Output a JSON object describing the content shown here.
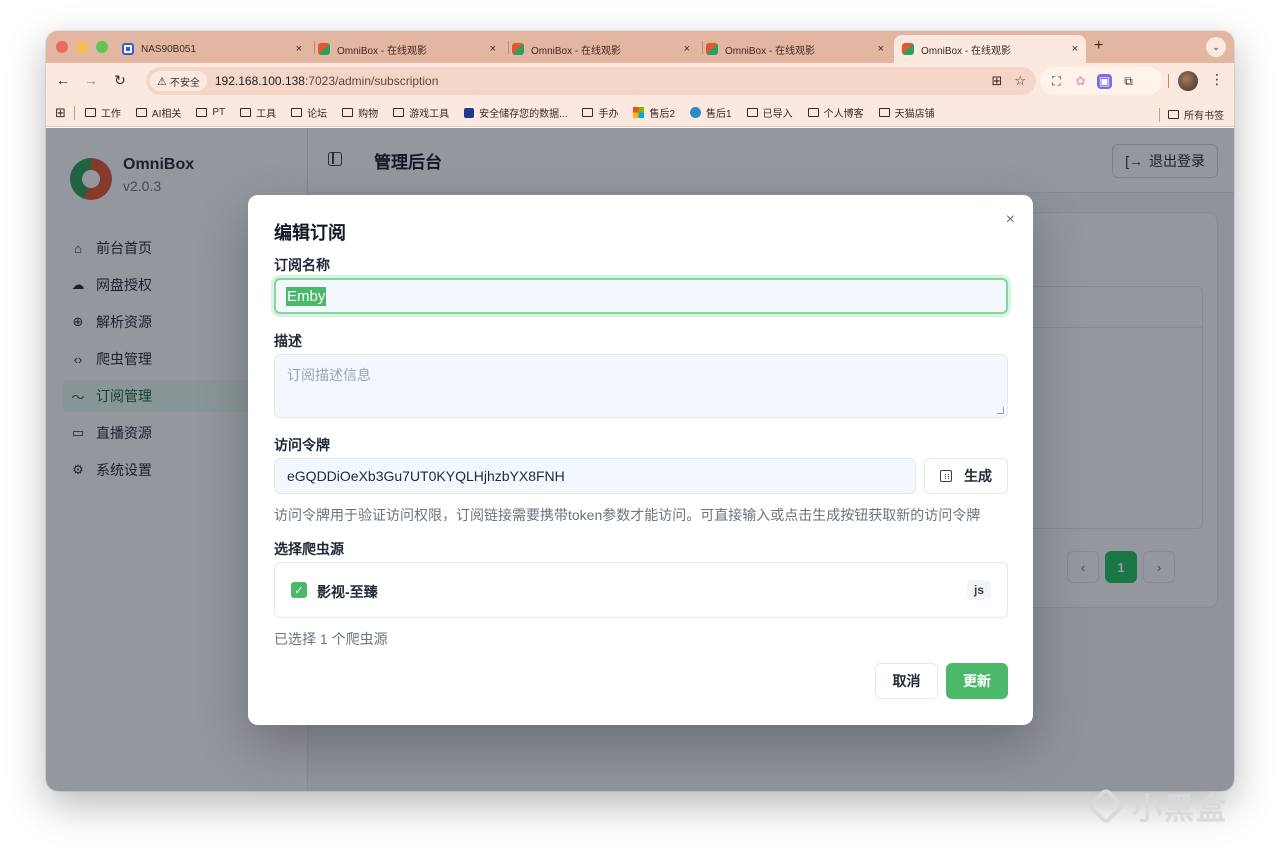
{
  "browser": {
    "tabs": [
      {
        "title": "NAS90B051",
        "icon": "nas-icon"
      },
      {
        "title": "OmniBox - 在线观影",
        "icon": "omnibox-icon"
      },
      {
        "title": "OmniBox - 在线观影",
        "icon": "omnibox-icon"
      },
      {
        "title": "OmniBox - 在线观影",
        "icon": "omnibox-icon"
      },
      {
        "title": "OmniBox - 在线观影",
        "icon": "omnibox-icon",
        "active": true
      }
    ],
    "close_glyph": "×",
    "new_tab_glyph": "+",
    "tab_menu_glyph": "⌄",
    "security_label": "不安全",
    "url_host": "192.168.100.138",
    "url_rest": ":7023/admin/subscription",
    "bookmarks": [
      "工作",
      "AI相关",
      "PT",
      "工具",
      "论坛",
      "购物",
      "游戏工具",
      "安全储存您的数据...",
      "手办",
      "售后2",
      "售后1",
      "已导入",
      "个人博客",
      "天猫店铺"
    ],
    "bookmarks_right": "所有书签"
  },
  "app": {
    "brand": {
      "name": "OmniBox",
      "version": "v2.0.3"
    },
    "nav": [
      {
        "label": "前台首页",
        "icon": "home-icon",
        "glyph": "⌂"
      },
      {
        "label": "网盘授权",
        "icon": "cloud-icon",
        "glyph": "☁"
      },
      {
        "label": "解析资源",
        "icon": "globe-icon",
        "glyph": "⊕"
      },
      {
        "label": "爬虫管理",
        "icon": "code-icon",
        "glyph": "‹›"
      },
      {
        "label": "订阅管理",
        "icon": "rss-icon",
        "glyph": "〜",
        "active": true
      },
      {
        "label": "直播资源",
        "icon": "tv-icon",
        "glyph": "▭"
      },
      {
        "label": "系统设置",
        "icon": "gear-icon",
        "glyph": "⚙"
      }
    ],
    "header_title": "管理后台",
    "logout_label": "退出登录",
    "pagination": {
      "current": "1",
      "prev": "‹",
      "next": "›"
    }
  },
  "modal": {
    "title": "编辑订阅",
    "close_glyph": "×",
    "name_label": "订阅名称",
    "name_value": "Emby",
    "desc_label": "描述",
    "desc_placeholder": "订阅描述信息",
    "token_label": "访问令牌",
    "token_value": "eGQDDiOeXb3Gu7UT0KYQLHjhzbYX8FNH",
    "generate_label": "生成",
    "help_text": "访问令牌用于验证访问权限，订阅链接需要携带token参数才能访问。可直接输入或点击生成按钮获取新的访问令牌",
    "source_label": "选择爬虫源",
    "sources": [
      {
        "name": "影视-至臻",
        "type": "js",
        "checked": true
      }
    ],
    "selected_count": "已选择 1 个爬虫源",
    "cancel_label": "取消",
    "update_label": "更新"
  },
  "watermark": "小黑盒",
  "colors": {
    "accent": "#4bb86a",
    "tabstrip": "#e3b6a2",
    "toolbar": "#fbe9e0"
  }
}
